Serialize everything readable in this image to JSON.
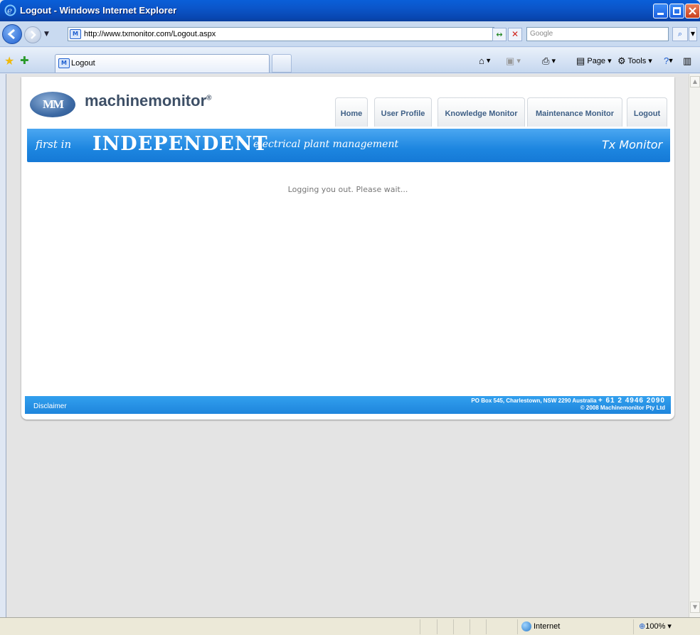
{
  "window": {
    "title": "Logout - Windows Internet Explorer"
  },
  "addressbar": {
    "url": "http://www.txmonitor.com/Logout.aspx",
    "search_placeholder": "Google"
  },
  "tabs": [
    {
      "label": "Logout"
    }
  ],
  "commandbar": {
    "page_label": "Page",
    "tools_label": "Tools"
  },
  "site": {
    "logo_text": "machinemonitor",
    "logo_mark": "MM",
    "nav": {
      "home": "Home",
      "user_profile": "User Profile",
      "knowledge_monitor": "Knowledge Monitor",
      "maintenance_monitor": "Maintenance Monitor",
      "logout": "Logout"
    },
    "banner": {
      "first_in": "first in",
      "independent": "INDEPENDENT",
      "tagline": "electrical plant management",
      "product": "Tx Monitor"
    },
    "message": "Logging you out. Please wait...",
    "footer": {
      "disclaimer": "Disclaimer",
      "address": "PO Box 545, Charlestown, NSW 2290 Australia",
      "phone": "+ 61 2 4946 2090",
      "copyright": "© 2008 Machinemonitor Pty Ltd"
    }
  },
  "statusbar": {
    "zone": "Internet",
    "zoom": "100%"
  },
  "icons": [
    "ie-icon",
    "back-arrow-icon",
    "forward-arrow-icon",
    "refresh-icon",
    "stop-icon",
    "search-icon",
    "favorites-star-icon",
    "add-favorites-icon",
    "home-icon",
    "feeds-icon",
    "print-icon",
    "page-icon",
    "tools-gear-icon",
    "help-icon",
    "globe-icon",
    "zoom-icon"
  ],
  "colors": {
    "titlebar": "#0b55c9",
    "banner_blue": "#1d86e0",
    "nav_text": "#3e5f86"
  }
}
